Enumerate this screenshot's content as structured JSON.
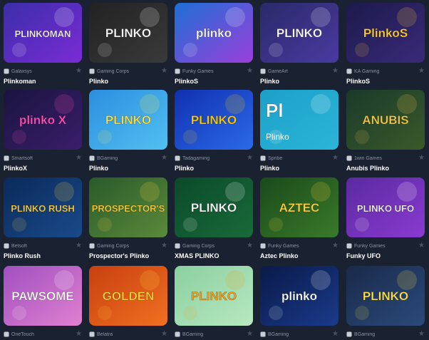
{
  "games": [
    {
      "title": "Plinkoman",
      "provider": "Galaxsys",
      "provider_icon": "galaxsys-icon",
      "art_text": "PLINKOMAN",
      "bg1": "#3b2ea8",
      "bg2": "#7a2bd6",
      "accent": "#ffffff"
    },
    {
      "title": "Plinko",
      "provider": "Gaming Corps",
      "provider_icon": "gaming-corps-icon",
      "art_text": "PLINKO",
      "bg1": "#222222",
      "bg2": "#3a3a3a",
      "accent": "#ffffff"
    },
    {
      "title": "PlinkoS",
      "provider": "Funky Games",
      "provider_icon": "funky-games-icon",
      "art_text": "plinko",
      "bg1": "#1d6fd6",
      "bg2": "#9b3fd8",
      "accent": "#ffffff"
    },
    {
      "title": "Plinko",
      "provider": "GameArt",
      "provider_icon": "gameart-icon",
      "art_text": "PLINKO",
      "bg1": "#2a2a6a",
      "bg2": "#4a3aa0",
      "accent": "#ffffff"
    },
    {
      "title": "PlinkoS",
      "provider": "KA Gaming",
      "provider_icon": "ka-gaming-icon",
      "art_text": "PlinkoS",
      "bg1": "#1c1a4a",
      "bg2": "#3a2a7a",
      "accent": "#ffcc33"
    },
    {
      "title": "PlinkoX",
      "provider": "Smartsoft",
      "provider_icon": "smartsoft-icon",
      "art_text": "plinko X",
      "bg1": "#1a1440",
      "bg2": "#3a1e6a",
      "accent": "#ff4fb8"
    },
    {
      "title": "Plinko",
      "provider": "BGaming",
      "provider_icon": "bgaming-icon",
      "art_text": "PLINKO",
      "bg1": "#2a8fe0",
      "bg2": "#52c0f0",
      "accent": "#ffe14a"
    },
    {
      "title": "Plinko",
      "provider": "Tadagaming",
      "provider_icon": "tadagaming-icon",
      "art_text": "PLINKO",
      "bg1": "#1030b0",
      "bg2": "#2b6ae8",
      "accent": "#ffcc00"
    },
    {
      "title": "Plinko",
      "provider": "Spribe",
      "provider_icon": "spribe-icon",
      "art_text": "Pl",
      "sub_text": "Plinko",
      "bg1": "#1da0c8",
      "bg2": "#2bb5d8",
      "accent": "#ffffff"
    },
    {
      "title": "Anubis Plinko",
      "provider": "1win Games",
      "provider_icon": "1win-games-icon",
      "art_text": "ANUBIS",
      "bg1": "#1a3a2a",
      "bg2": "#3a5a2a",
      "accent": "#f2c94c"
    },
    {
      "title": "Plinko Rush",
      "provider": "Betsoft",
      "provider_icon": "betsoft-icon",
      "art_text": "PLINKO RUSH",
      "bg1": "#0a2a5a",
      "bg2": "#1a4a8a",
      "accent": "#ffd23f"
    },
    {
      "title": "Prospector's Plinko",
      "provider": "Gaming Corps",
      "provider_icon": "gaming-corps-icon",
      "art_text": "PROSPECTOR'S",
      "bg1": "#2a5a2a",
      "bg2": "#5a8a3a",
      "accent": "#ffd23f"
    },
    {
      "title": "XMAS PLINKO",
      "provider": "Gaming Corps",
      "provider_icon": "gaming-corps-icon",
      "art_text": "PLINKO",
      "bg1": "#0a4a2a",
      "bg2": "#1a6a3a",
      "accent": "#ffffff"
    },
    {
      "title": "Aztec Plinko",
      "provider": "Funky Games",
      "provider_icon": "funky-games-icon",
      "art_text": "AZTEC",
      "bg1": "#1a4a1a",
      "bg2": "#3a7a2a",
      "accent": "#ffd23f"
    },
    {
      "title": "Funky UFO",
      "provider": "Funky Games",
      "provider_icon": "funky-games-icon",
      "art_text": "PLINKO UFO",
      "bg1": "#5a2aa0",
      "bg2": "#8a3ad0",
      "accent": "#ffffff"
    },
    {
      "title": "",
      "provider": "OneTouch",
      "provider_icon": "onetouch-icon",
      "art_text": "PAWSOME",
      "bg1": "#a050c0",
      "bg2": "#e080d0",
      "accent": "#ffffff"
    },
    {
      "title": "",
      "provider": "Belatra",
      "provider_icon": "belatra-icon",
      "art_text": "GOLDEN",
      "bg1": "#c84010",
      "bg2": "#f07020",
      "accent": "#ffd23f"
    },
    {
      "title": "",
      "provider": "BGaming",
      "provider_icon": "bgaming-icon",
      "art_text": "PLINKO",
      "bg1": "#8ad0a0",
      "bg2": "#b8e8c0",
      "accent": "#f0a020"
    },
    {
      "title": "",
      "provider": "BGaming",
      "provider_icon": "bgaming-icon",
      "art_text": "plinko",
      "bg1": "#0a1a4a",
      "bg2": "#1a3a8a",
      "accent": "#ffffff"
    },
    {
      "title": "",
      "provider": "BGaming",
      "provider_icon": "bgaming-icon",
      "art_text": "PLINKO",
      "bg1": "#1a2a4a",
      "bg2": "#2a4a7a",
      "accent": "#ffe14a"
    }
  ],
  "favorite_icon": "star-icon"
}
